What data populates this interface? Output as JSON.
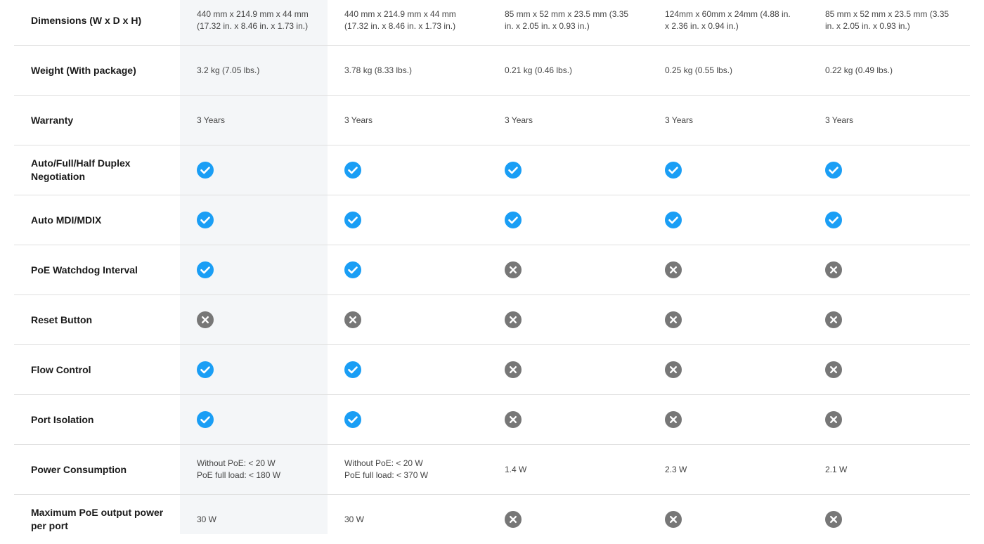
{
  "colors": {
    "check": "#1a9ef5",
    "cross": "#777777",
    "highlight": "#f4f6f8"
  },
  "rows": [
    {
      "label": "Dimensions (W x D x H)",
      "cells": [
        {
          "type": "text",
          "lines": [
            "440 mm x 214.9 mm x 44 mm (17.32 in. x 8.46 in. x 1.73 in.)"
          ]
        },
        {
          "type": "text",
          "lines": [
            "440 mm x 214.9 mm x 44 mm (17.32 in. x 8.46 in. x 1.73 in.)"
          ]
        },
        {
          "type": "text",
          "lines": [
            "85 mm x 52 mm x 23.5 mm (3.35 in. x 2.05 in. x 0.93 in.)"
          ]
        },
        {
          "type": "text",
          "lines": [
            "124mm x 60mm x 24mm (4.88 in. x 2.36 in. x 0.94 in.)"
          ]
        },
        {
          "type": "text",
          "lines": [
            "85 mm x 52 mm x 23.5 mm (3.35 in. x 2.05 in. x 0.93 in.)"
          ]
        }
      ]
    },
    {
      "label": "Weight (With package)",
      "cells": [
        {
          "type": "text",
          "lines": [
            "3.2 kg (7.05 lbs.)"
          ]
        },
        {
          "type": "text",
          "lines": [
            "3.78 kg (8.33 lbs.)"
          ]
        },
        {
          "type": "text",
          "lines": [
            "0.21 kg (0.46 lbs.)"
          ]
        },
        {
          "type": "text",
          "lines": [
            "0.25 kg (0.55 lbs.)"
          ]
        },
        {
          "type": "text",
          "lines": [
            "0.22 kg (0.49 lbs.)"
          ]
        }
      ]
    },
    {
      "label": "Warranty",
      "cells": [
        {
          "type": "text",
          "lines": [
            "3 Years"
          ]
        },
        {
          "type": "text",
          "lines": [
            "3 Years"
          ]
        },
        {
          "type": "text",
          "lines": [
            "3 Years"
          ]
        },
        {
          "type": "text",
          "lines": [
            "3 Years"
          ]
        },
        {
          "type": "text",
          "lines": [
            "3 Years"
          ]
        }
      ]
    },
    {
      "label": "Auto/Full/Half Duplex Negotiation",
      "cells": [
        {
          "type": "check"
        },
        {
          "type": "check"
        },
        {
          "type": "check"
        },
        {
          "type": "check"
        },
        {
          "type": "check"
        }
      ]
    },
    {
      "label": "Auto MDI/MDIX",
      "cells": [
        {
          "type": "check"
        },
        {
          "type": "check"
        },
        {
          "type": "check"
        },
        {
          "type": "check"
        },
        {
          "type": "check"
        }
      ]
    },
    {
      "label": "PoE Watchdog Interval",
      "cells": [
        {
          "type": "check"
        },
        {
          "type": "check"
        },
        {
          "type": "cross"
        },
        {
          "type": "cross"
        },
        {
          "type": "cross"
        }
      ]
    },
    {
      "label": "Reset Button",
      "cells": [
        {
          "type": "cross"
        },
        {
          "type": "cross"
        },
        {
          "type": "cross"
        },
        {
          "type": "cross"
        },
        {
          "type": "cross"
        }
      ]
    },
    {
      "label": "Flow Control",
      "cells": [
        {
          "type": "check"
        },
        {
          "type": "check"
        },
        {
          "type": "cross"
        },
        {
          "type": "cross"
        },
        {
          "type": "cross"
        }
      ]
    },
    {
      "label": "Port Isolation",
      "cells": [
        {
          "type": "check"
        },
        {
          "type": "check"
        },
        {
          "type": "cross"
        },
        {
          "type": "cross"
        },
        {
          "type": "cross"
        }
      ]
    },
    {
      "label": "Power Consumption",
      "cells": [
        {
          "type": "text",
          "lines": [
            "Without PoE: < 20 W",
            "PoE full load: < 180 W"
          ]
        },
        {
          "type": "text",
          "lines": [
            "Without PoE: < 20 W",
            "PoE full load: < 370 W"
          ]
        },
        {
          "type": "text",
          "lines": [
            "1.4 W"
          ]
        },
        {
          "type": "text",
          "lines": [
            "2.3 W"
          ]
        },
        {
          "type": "text",
          "lines": [
            "2.1 W"
          ]
        }
      ]
    },
    {
      "label": "Maximum PoE output power per port",
      "cells": [
        {
          "type": "text",
          "lines": [
            "30 W"
          ]
        },
        {
          "type": "text",
          "lines": [
            "30 W"
          ]
        },
        {
          "type": "cross"
        },
        {
          "type": "cross"
        },
        {
          "type": "cross"
        }
      ]
    }
  ]
}
